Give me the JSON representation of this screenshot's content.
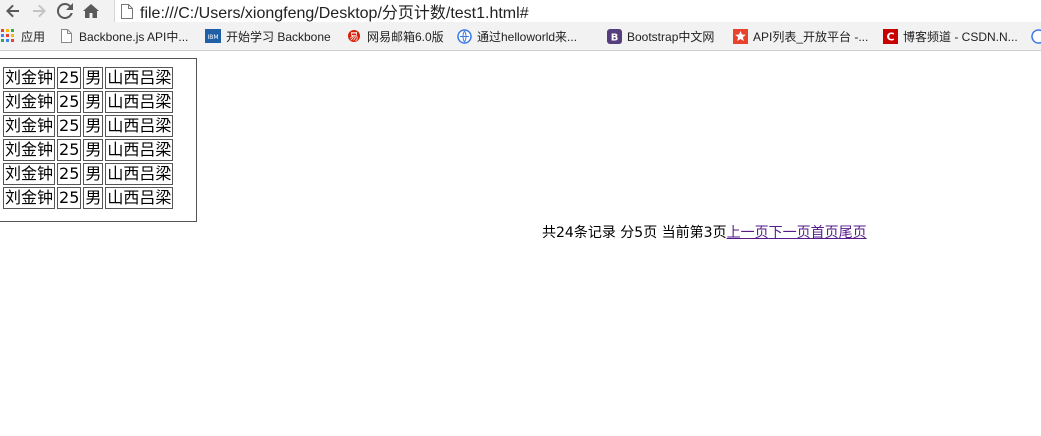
{
  "browser": {
    "address": "file:///C:/Users/xiongfeng/Desktop/分页计数/test1.html#",
    "bookmarks": [
      {
        "label": "应用",
        "icon": "apps-grid-icon"
      },
      {
        "label": "Backbone.js API中...",
        "icon": "page-icon"
      },
      {
        "label": "开始学习 Backbone",
        "icon": "ibm-icon"
      },
      {
        "label": "网易邮箱6.0版",
        "icon": "netease-icon"
      },
      {
        "label": "通过helloworld来...",
        "icon": "globe-icon"
      },
      {
        "label": "Bootstrap中文网",
        "icon": "bootstrap-icon"
      },
      {
        "label": "API列表_开放平台 -...",
        "icon": "star-icon"
      },
      {
        "label": "博客频道 - CSDN.N...",
        "icon": "csdn-icon"
      }
    ]
  },
  "table": {
    "rows": [
      [
        "刘金钟",
        "25",
        "男",
        "山西吕梁"
      ],
      [
        "刘金钟",
        "25",
        "男",
        "山西吕梁"
      ],
      [
        "刘金钟",
        "25",
        "男",
        "山西吕梁"
      ],
      [
        "刘金钟",
        "25",
        "男",
        "山西吕梁"
      ],
      [
        "刘金钟",
        "25",
        "男",
        "山西吕梁"
      ],
      [
        "刘金钟",
        "25",
        "男",
        "山西吕梁"
      ]
    ]
  },
  "pager": {
    "total": "共24条记录",
    "pages": "分5页",
    "current": "当前第3页",
    "prev": "上一页",
    "next": "下一页",
    "first": "首页",
    "last": "尾页"
  },
  "colors": {
    "link": "#551a8b"
  }
}
